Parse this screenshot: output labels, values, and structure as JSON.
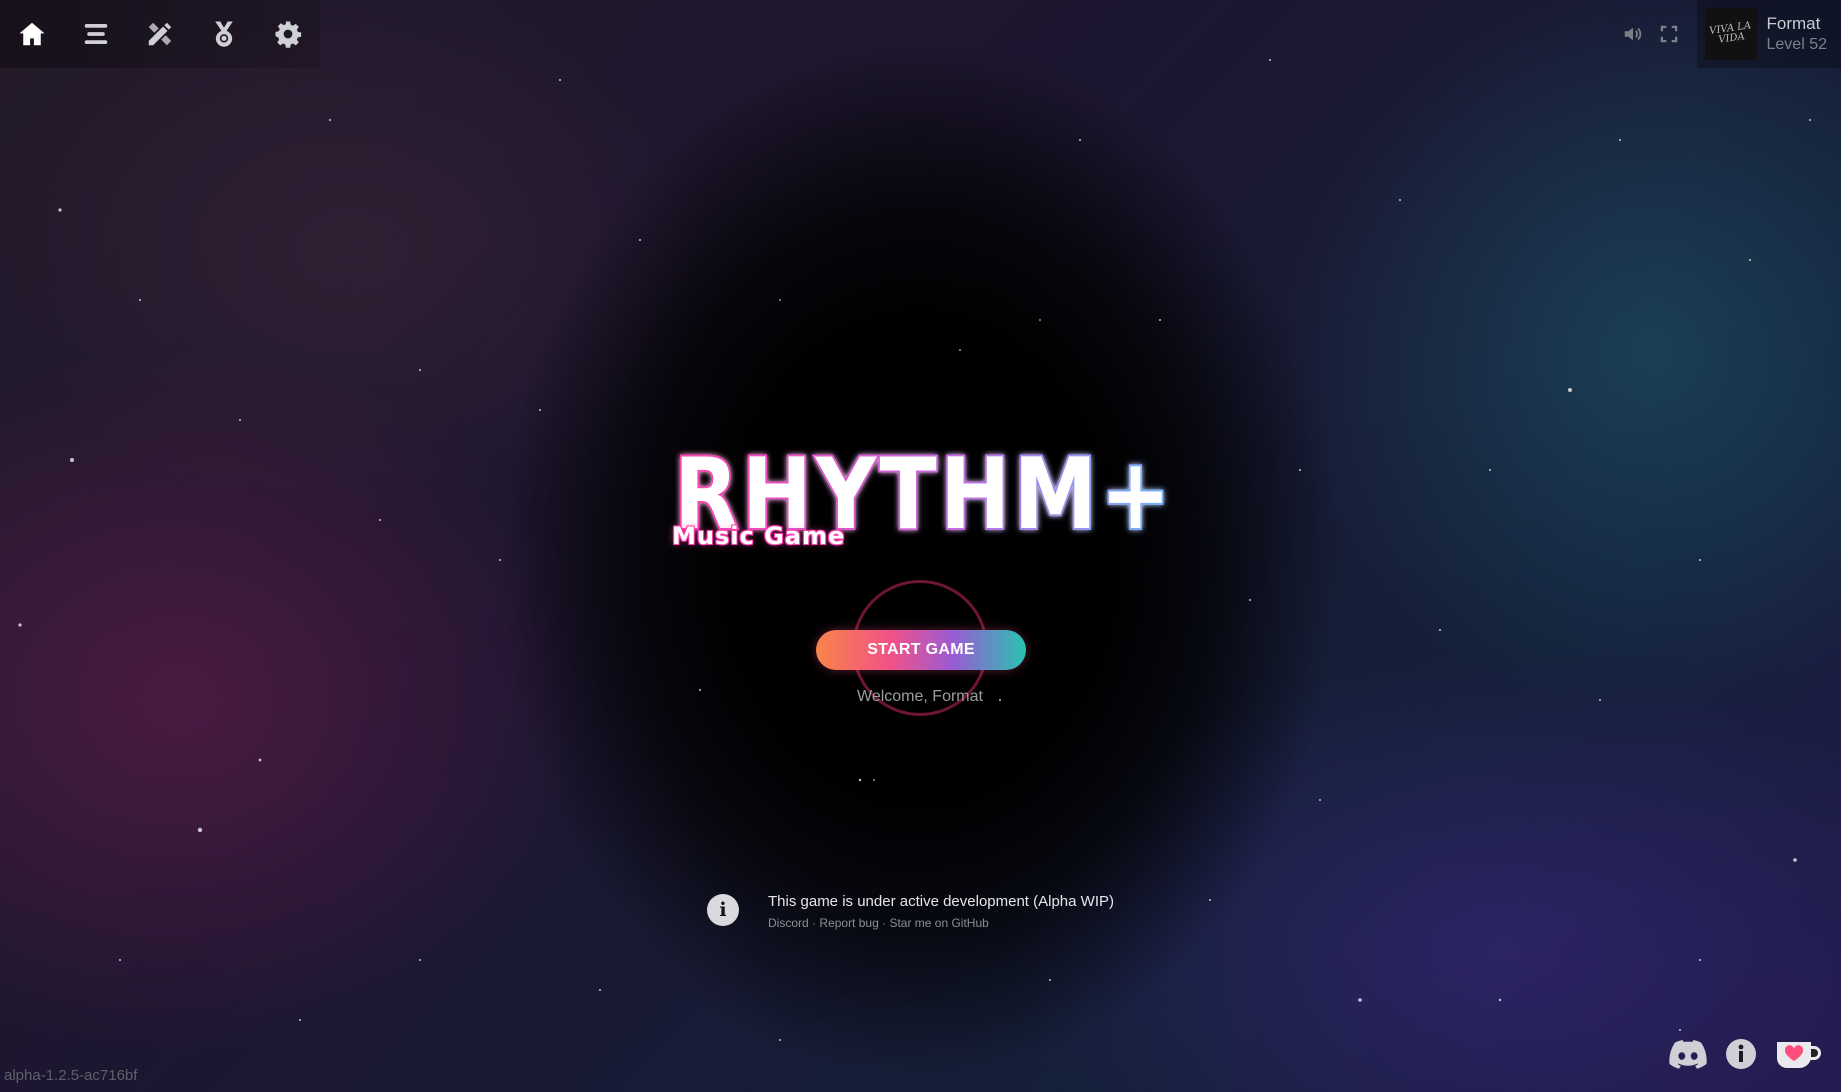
{
  "nav": {
    "items": [
      {
        "name": "home",
        "icon": "home-icon"
      },
      {
        "name": "song-list",
        "icon": "list-icon"
      },
      {
        "name": "editor",
        "icon": "pencil-ruler-icon"
      },
      {
        "name": "achievements",
        "icon": "medal-icon"
      },
      {
        "name": "settings",
        "icon": "gear-icon"
      }
    ]
  },
  "header": {
    "volume_icon": "volume-icon",
    "fullscreen_icon": "fullscreen-icon",
    "avatar_icon": "avatar-image",
    "avatar_text": "VIVA LA VIDA",
    "username": "Format",
    "level": "Level 52"
  },
  "logo": {
    "title": "RHYTHM+",
    "subtitle": "Music Game",
    "colors": {
      "pink": "#ff3fb0",
      "blue": "#6fb7ff",
      "white": "#ffffff"
    }
  },
  "start": {
    "label": "START GAME",
    "welcome": "Welcome, Format",
    "gradient": [
      "#f8844a",
      "#f25287",
      "#9b5bd4",
      "#29c2b0"
    ]
  },
  "notice": {
    "icon": "info-icon",
    "main": "This game is under active development (Alpha WIP)",
    "links": [
      "Discord",
      "Report bug",
      "Star me on GitHub"
    ],
    "separator": "·"
  },
  "version": "alpha-1.2.5-ac716bf",
  "footer_icons": [
    "discord-icon",
    "info-icon",
    "kofi-icon"
  ]
}
